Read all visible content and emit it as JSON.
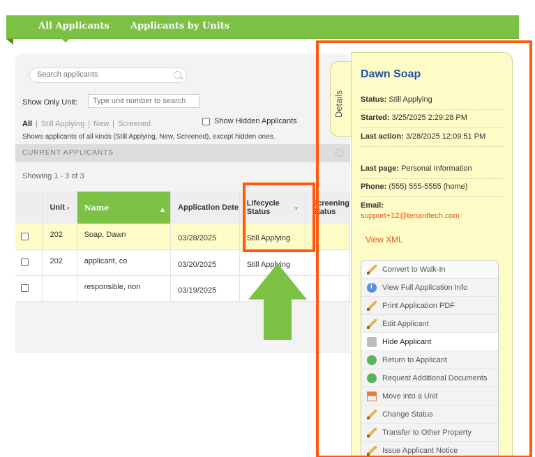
{
  "tabs": [
    {
      "label": "All Applicants"
    },
    {
      "label": "Applicants by Units"
    }
  ],
  "search": {
    "placeholder": "Search applicants"
  },
  "unit_filter": {
    "label": "Show Only Unit:",
    "placeholder": "Type unit number to search"
  },
  "filters": {
    "items": [
      "All",
      "Still Applying",
      "New",
      "Screened"
    ],
    "separator": "|",
    "active": "All",
    "show_hidden_label": "Show Hidden Applicants",
    "description": "Shows applicants of all kinds (Still Applying, New, Screened), except hidden ones."
  },
  "section": {
    "title": "CURRENT APPLICANTS"
  },
  "showing": "Showing 1 - 3 of 3",
  "table": {
    "columns": {
      "unit": "Unit",
      "name": "Name",
      "app_date": "Application Date",
      "lifecycle": "Lifecycle Status",
      "screening": "Screening Status"
    },
    "rows": [
      {
        "unit": "202",
        "name": "Soap, Dawn",
        "date": "03/28/2025",
        "status": "Still Applying",
        "screening": ""
      },
      {
        "unit": "202",
        "name": "applicant, co",
        "date": "03/20/2025",
        "status": "Still Applying",
        "screening": ""
      },
      {
        "unit": "",
        "name": "responsible, non",
        "date": "03/19/2025",
        "status": "",
        "screening": ""
      }
    ]
  },
  "details_tab": "Details",
  "details": {
    "name": "Dawn Soap",
    "status_label": "Status:",
    "status_value": "Still Applying",
    "started_label": "Started:",
    "started_value": "3/25/2025 2:29:28 PM",
    "last_action_label": "Last action:",
    "last_action_value": "3/28/2025 12:09:51 PM",
    "last_page_label": "Last page:",
    "last_page_value": "Personal Information",
    "phone_label": "Phone:",
    "phone_value": "(555) 555-5555 (home)",
    "email_label": "Email:",
    "email_value": "support+12@tenanttech.com",
    "view_xml": "View XML"
  },
  "actions": [
    {
      "label": "Convert to Walk-In",
      "icon": "pencil-icon"
    },
    {
      "label": "View Full Application Info",
      "icon": "info-icon"
    },
    {
      "label": "Print Application PDF",
      "icon": "pencil-icon"
    },
    {
      "label": "Edit Applicant",
      "icon": "pencil-icon"
    },
    {
      "label": "Hide Applicant",
      "icon": "trash-icon"
    },
    {
      "label": "Return to Applicant",
      "icon": "return-icon"
    },
    {
      "label": "Request Additional Documents",
      "icon": "return-icon"
    },
    {
      "label": "Move into a Unit",
      "icon": "home-icon"
    },
    {
      "label": "Change Status",
      "icon": "pencil-icon"
    },
    {
      "label": "Transfer to Other Property",
      "icon": "pencil-icon"
    },
    {
      "label": "Issue Applicant Notice",
      "icon": "pencil-icon"
    }
  ],
  "colors": {
    "brand_green": "#7cc143",
    "highlight_orange": "#ff5a10",
    "details_bg": "#fdfbc6",
    "name_blue": "#2254a6",
    "link_orange": "#e8531e"
  }
}
